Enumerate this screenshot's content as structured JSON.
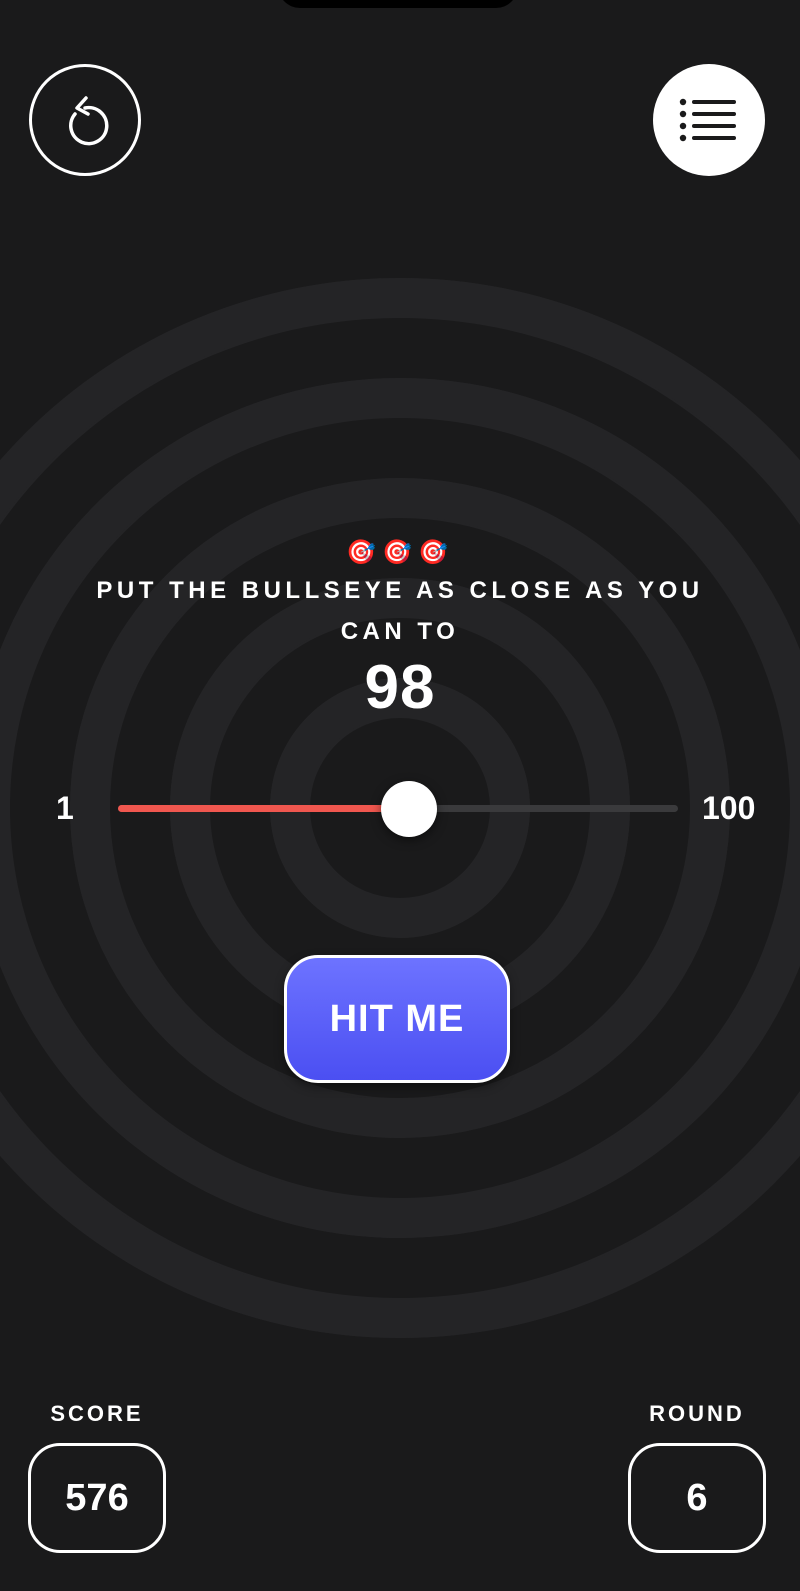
{
  "header": {
    "restart_icon": "restart-arrow-icon",
    "leaderboard_icon": "list-icon"
  },
  "instructions": {
    "emojis": "🎯🎯🎯",
    "text": "PUT THE BULLSEYE AS CLOSE AS YOU CAN TO",
    "target_value": "98"
  },
  "slider": {
    "min_label": "1",
    "max_label": "100",
    "value_fraction": 0.52
  },
  "hit_button": {
    "label": "HIT ME"
  },
  "stats": {
    "score_label": "SCORE",
    "score_value": "576",
    "round_label": "ROUND",
    "round_value": "6"
  },
  "colors": {
    "background": "#1a1a1b",
    "ring": "#242426",
    "accent_red": "#f0574f",
    "button_blue": "#5b60f8",
    "white": "#ffffff"
  }
}
